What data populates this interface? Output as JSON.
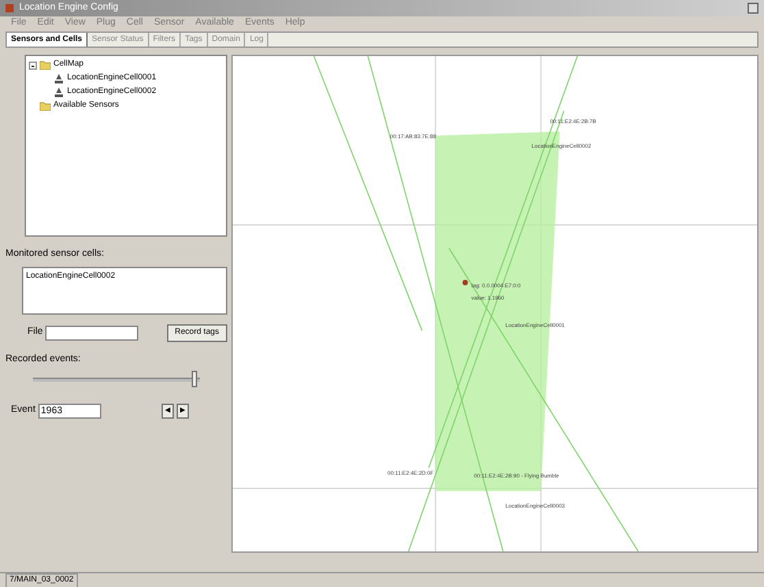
{
  "window": {
    "title": "Location Engine Config"
  },
  "menu": [
    "File",
    "Edit",
    "View",
    "Plug",
    "Cell",
    "Sensor",
    "Available",
    "Events",
    "Help"
  ],
  "tabs": [
    {
      "label": "Sensors and Cells",
      "selected": true
    },
    {
      "label": "Sensor Status",
      "selected": false
    },
    {
      "label": "Filters",
      "selected": false
    },
    {
      "label": "Tags",
      "selected": false
    },
    {
      "label": "Domain",
      "selected": false
    },
    {
      "label": "Log",
      "selected": false
    }
  ],
  "tree": [
    {
      "label": "CellMap",
      "expanded": true,
      "kind": "folder",
      "children": [
        {
          "label": "LocationEngineCell0001",
          "kind": "sensor"
        },
        {
          "label": "LocationEngineCell0002",
          "kind": "sensor"
        }
      ]
    },
    {
      "label": "Available Sensors",
      "kind": "folder"
    }
  ],
  "monitored": {
    "label": "Monitored sensor cells:",
    "items": [
      "LocationEngineCell0002"
    ]
  },
  "file": {
    "label": "File",
    "button": "Record tags"
  },
  "recorded": {
    "label": "Recorded events:",
    "level": 0.98
  },
  "event": {
    "label": "Event",
    "value": "1963",
    "prev": "◀",
    "next": "▶"
  },
  "canvas": {
    "labels": [
      "00:17:AB:83:7E:88",
      "00:11:E2:4E:2B:7B",
      "LocationEngineCell0002",
      "tag: 0.0.0004:E7:0:0",
      "value: 1.1960",
      "LocationEngineCell0001",
      "00:11:E2:4E:2D:0F",
      "00:11:E2:4E:2B:90 - Flying Bumble",
      "LocationEngineCell0003"
    ]
  },
  "status_bar": "7/MAIN_03_0002"
}
